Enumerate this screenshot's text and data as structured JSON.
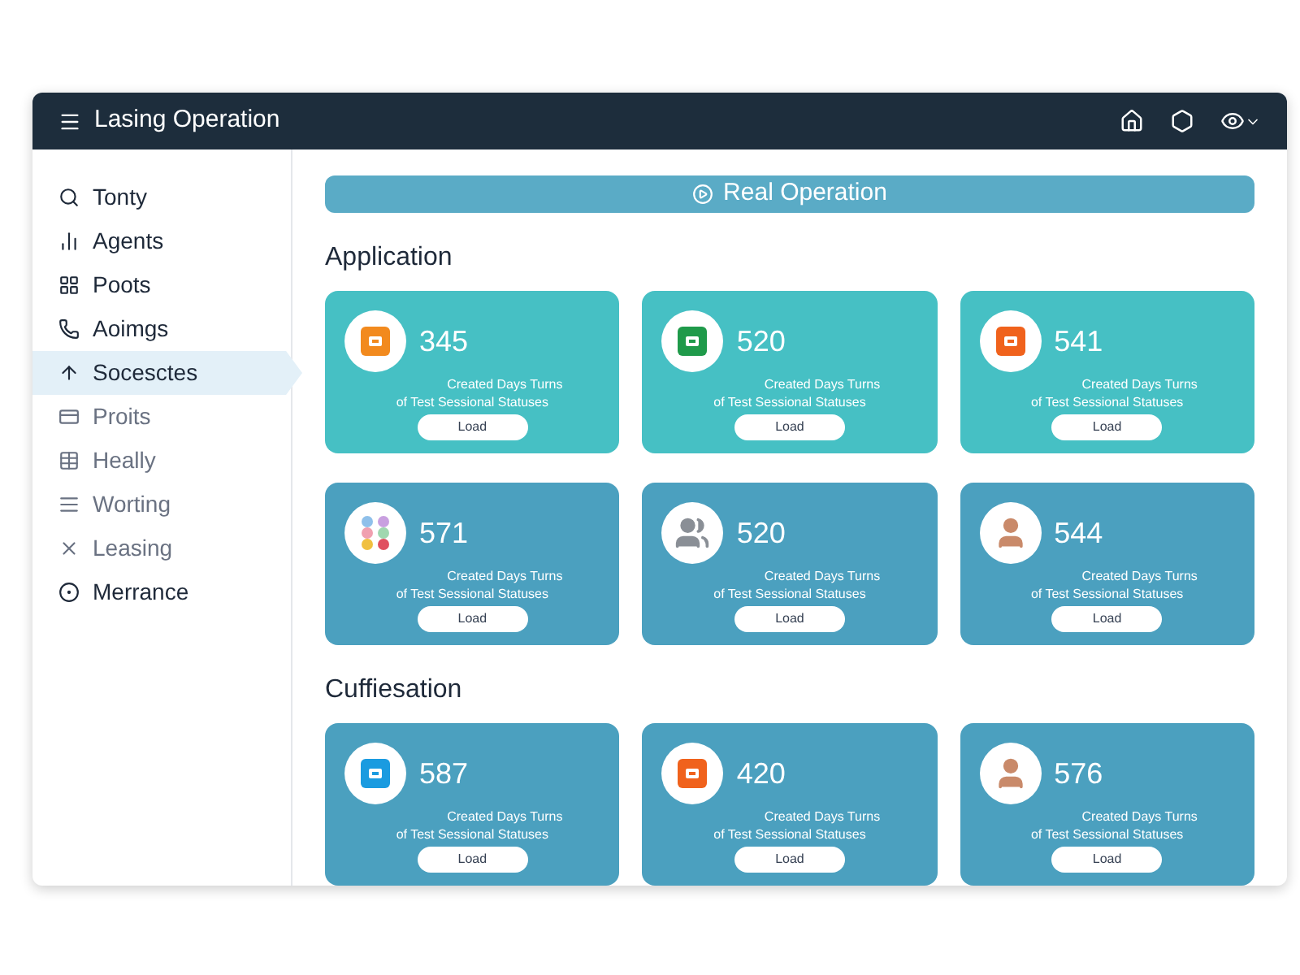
{
  "window": {
    "title": "Lasing Operation"
  },
  "sidebar": {
    "items": [
      {
        "label": "Tonty",
        "selected": false,
        "disabled": false
      },
      {
        "label": "Agents",
        "selected": false,
        "disabled": false
      },
      {
        "label": "Poots",
        "selected": false,
        "disabled": false
      },
      {
        "label": "Aoimgs",
        "selected": false,
        "disabled": false
      },
      {
        "label": "Socesctes",
        "selected": true,
        "disabled": false
      },
      {
        "label": "Proits",
        "selected": false,
        "disabled": true
      },
      {
        "label": "Heally",
        "selected": false,
        "disabled": true
      },
      {
        "label": "Worting",
        "selected": false,
        "disabled": true
      },
      {
        "label": "Leasing",
        "selected": false,
        "disabled": true
      },
      {
        "label": "Merrance",
        "selected": false,
        "disabled": false
      }
    ]
  },
  "action_button": {
    "label": "Real Operation"
  },
  "sections": [
    {
      "title": "Application",
      "color": "#46c0c4",
      "cards": [
        {
          "value": "345",
          "kind": "tile",
          "color": "#f28a1e",
          "line_1": "Created Days Turns",
          "line_2": "of Test Sessional Statuses",
          "button": "Load"
        },
        {
          "value": "520",
          "kind": "tile",
          "color": "#1f9a4a",
          "line_1": "Created Days Turns",
          "line_2": "of Test Sessional Statuses",
          "button": "Load"
        },
        {
          "value": "541",
          "kind": "tile",
          "color": "#f0621c",
          "line_1": "Created Days Turns",
          "line_2": "of Test Sessional Statuses",
          "button": "Load"
        }
      ]
    },
    {
      "color": "#4ba0bf",
      "cards": [
        {
          "value": "571",
          "kind": "palette",
          "color": "#f0c040",
          "line_1": "Created Days Turns",
          "line_2": "of Test Sessional Statuses",
          "button": "Load"
        },
        {
          "value": "520",
          "kind": "group",
          "color": "#8a8f96",
          "line_1": "Created Days Turns",
          "line_2": "of Test Sessional Statuses",
          "button": "Load"
        },
        {
          "value": "544",
          "kind": "person",
          "color": "#c98a6a",
          "line_1": "Created Days Turns",
          "line_2": "of Test Sessional Statuses",
          "button": "Load"
        }
      ]
    },
    {
      "title": "Cuffiesation",
      "color": "#4ba0bf",
      "cards": [
        {
          "value": "587",
          "kind": "tile",
          "color": "#1a9be0",
          "line_1": "Created Days Turns",
          "line_2": "of Test Sessional Statuses",
          "button": "Load"
        },
        {
          "value": "420",
          "kind": "tile",
          "color": "#f0621c",
          "line_1": "Created Days Turns",
          "line_2": "of Test Sessional Statuses",
          "button": "Load"
        },
        {
          "value": "576",
          "kind": "person",
          "color": "#c98a6a",
          "line_1": "Created Days Turns",
          "line_2": "of Test Sessional Statuses",
          "button": "Load"
        }
      ]
    }
  ]
}
